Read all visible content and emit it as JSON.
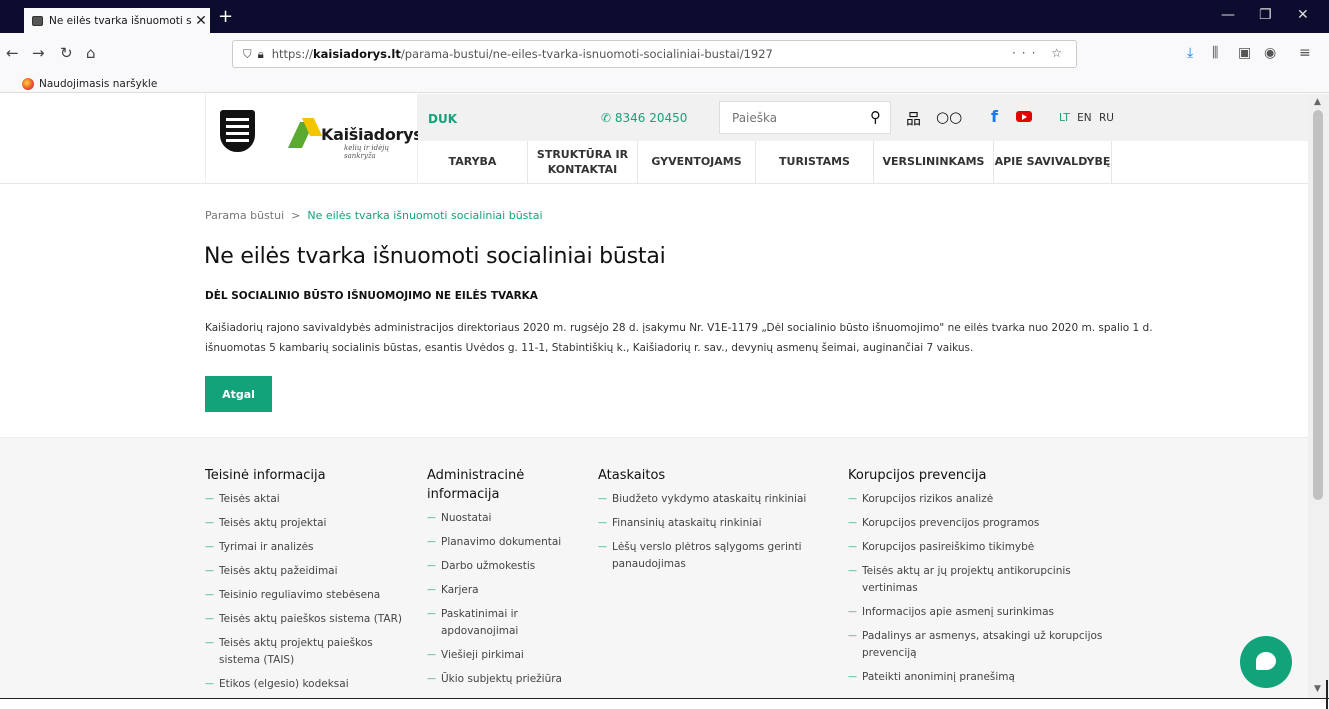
{
  "browser": {
    "tab_title": "Ne eilės tvarka išnuomoti socia",
    "url_prefix": "https://",
    "url_domain": "kaisiadorys.lt",
    "url_path": "/parama-bustui/ne-eiles-tvarka-isnuomoti-socialiniai-bustai/1927",
    "bookmark": "Naudojimasis naršykle"
  },
  "header": {
    "brand_name": "Kaišiadorys",
    "brand_slogan": "kelių ir idėjų sankryža",
    "duk": "DUK",
    "phone": "8346 20450",
    "search_placeholder": "Paieška",
    "languages": [
      "LT",
      "EN",
      "RU"
    ],
    "menu": [
      "TARYBA",
      "STRUKTŪRA IR KONTAKTAI",
      "GYVENTOJAMS",
      "TURISTAMS",
      "VERSLININKAMS",
      "APIE SAVIVALDYBĘ"
    ]
  },
  "breadcrumb": {
    "parent": "Parama būstui",
    "separator": ">",
    "current": "Ne eilės tvarka išnuomoti socialiniai būstai"
  },
  "article": {
    "title": "Ne eilės tvarka išnuomoti socialiniai būstai",
    "subtitle": "DĖL SOCIALINIO BŪSTO IŠNUOMOJIMO NE EILĖS TVARKA",
    "text": "Kaišiadorių rajono savivaldybės administracijos direktoriaus 2020 m. rugsėjo 28 d. įsakymu Nr. V1E-1179 „Dėl socialinio būsto išnuomojimo\" ne eilės tvarka nuo 2020 m. spalio 1 d.  išnuomotas 5 kambarių socialinis būstas, esantis Uvėdos g. 11-1, Stabintiškių k., Kaišiadorių r. sav., devynių asmenų šeimai, auginančiai 7 vaikus.",
    "back_label": "Atgal"
  },
  "footer": {
    "col1": {
      "title": "Teisinė informacija",
      "items": [
        "Teisės aktai",
        "Teisės aktų projektai",
        "Tyrimai ir analizės",
        "Teisės aktų pažeidimai",
        "Teisinio reguliavimo stebėsena",
        "Teisės aktų paieškos sistema (TAR)",
        "Teisės aktų projektų paieškos sistema (TAIS)",
        "Etikos (elgesio) kodeksai"
      ]
    },
    "col2": {
      "title": "Administracinė informacija",
      "items": [
        "Nuostatai",
        "Planavimo dokumentai",
        "Darbo užmokestis",
        "Karjera",
        "Paskatinimai ir apdovanojimai",
        "Viešieji pirkimai",
        "Ūkio subjektų priežiūra"
      ]
    },
    "col3": {
      "title": "Ataskaitos",
      "items": [
        "Biudžeto vykdymo ataskaitų rinkiniai",
        "Finansinių ataskaitų rinkiniai",
        "Lėšų verslo plėtros sąlygoms gerinti panaudojimas"
      ]
    },
    "col4": {
      "title": "Korupcijos prevencija",
      "items": [
        "Korupcijos rizikos analizė",
        "Korupcijos prevencijos programos",
        "Korupcijos pasireiškimo tikimybė",
        "Teisės aktų ar jų projektų antikorupcinis vertinimas",
        "Informacijos apie asmenį surinkimas",
        "Padalinys ar asmenys, atsakingi už korupcijos prevenciją",
        "Pateikti anoniminį pranešimą"
      ]
    }
  },
  "colors": {
    "accent": "#13a37b",
    "tabbar": "#0c0c2f"
  }
}
